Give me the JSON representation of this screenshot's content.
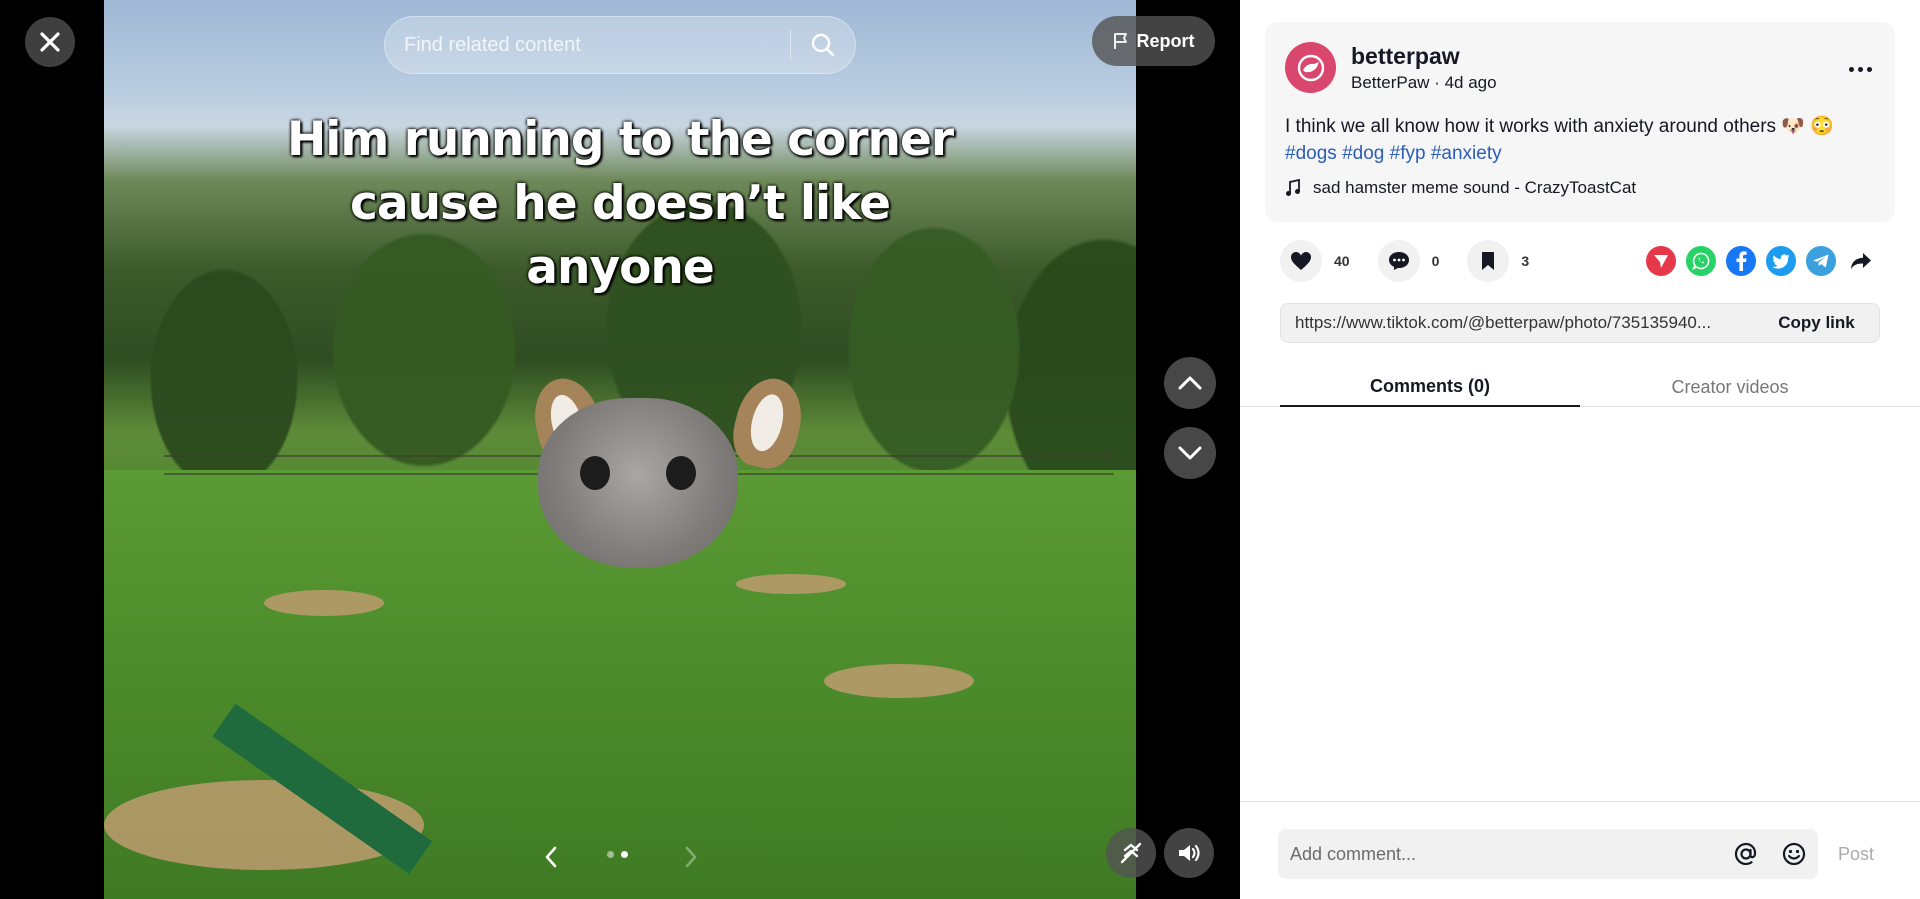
{
  "viewer": {
    "caption_lines": [
      "Him running to the corner",
      "cause he doesn’t like",
      "anyone"
    ],
    "search_placeholder": "Find related content",
    "report_label": "Report",
    "slide_count": 2,
    "active_slide": 2
  },
  "post": {
    "username": "betterpaw",
    "display_name": "BetterPaw",
    "time_ago": "4d ago",
    "description_text": "I think we all know how it works with anxiety around others 🐶 😳",
    "hashtags": [
      "#dogs",
      "#dog",
      "#fyp",
      "#anxiety"
    ],
    "music": "sad hamster meme sound - CrazyToastCat"
  },
  "stats": {
    "likes": "40",
    "comments": "0",
    "saves": "3"
  },
  "share_colors": {
    "repost": "#e5394b",
    "whatsapp": "#25d366",
    "facebook": "#1877f2",
    "twitter": "#1d9bf0",
    "telegram": "#3aa1de"
  },
  "link": {
    "url": "https://www.tiktok.com/@betterpaw/photo/735135940...",
    "copy_label": "Copy link"
  },
  "tabs": {
    "comments": "Comments (0)",
    "creator_videos": "Creator videos"
  },
  "comment_input": {
    "placeholder": "Add comment...",
    "post_label": "Post"
  }
}
